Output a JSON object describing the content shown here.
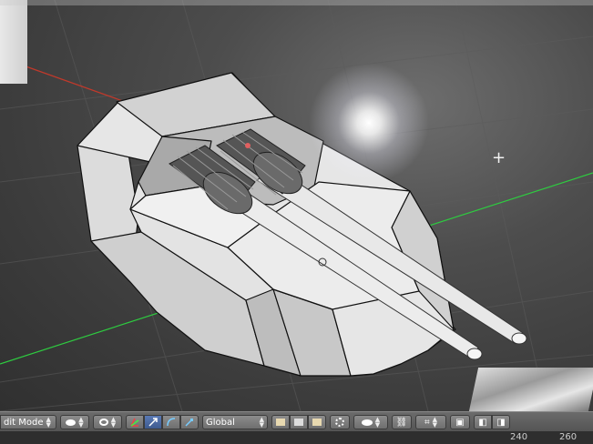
{
  "header": {
    "mode": "dit Mode",
    "shading_icon": "sphere-icon",
    "pivot_icon": "pivot-icon",
    "widget_icons": [
      "axes-manipulator-icon",
      "translate-icon",
      "rotate-icon",
      "scale-icon"
    ],
    "orientation": "Global",
    "layer_icons": [
      "layer-1-icon",
      "layer-2-icon",
      "layer-3-icon"
    ],
    "snap_icon": "snap-icon",
    "proportional_icon": "proportional-edit-icon",
    "link_icon": "link-icon",
    "magnet_icon": "magnet-icon",
    "render_icons": [
      "render-icon",
      "render-anim-icon"
    ]
  },
  "status": {
    "values": [
      "240",
      "260"
    ]
  },
  "colors": {
    "x_axis": "#c0392b",
    "y_axis": "#2ecc40",
    "mesh_face": "#d6d6d6",
    "mesh_edge": "#111111",
    "viewport_bg": "#4a4a4a",
    "header_bg": "#5f5f5f"
  }
}
